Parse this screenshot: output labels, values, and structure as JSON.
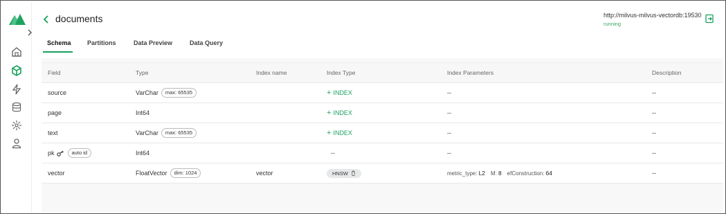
{
  "header": {
    "title": "documents",
    "connection_url": "http://milvus-milvus-vectordb:19530",
    "connection_status": "running"
  },
  "tabs": [
    {
      "label": "Schema",
      "active": true
    },
    {
      "label": "Partitions",
      "active": false
    },
    {
      "label": "Data Preview",
      "active": false
    },
    {
      "label": "Data Query",
      "active": false
    }
  ],
  "table": {
    "columns": [
      "Field",
      "Type",
      "Index name",
      "Index Type",
      "Index Parameters",
      "Description"
    ],
    "rows": [
      {
        "field": "source",
        "type": "VarChar",
        "type_chip": "max: 65535",
        "index_name": "",
        "index_type": "INDEX",
        "params": "--",
        "description": "--"
      },
      {
        "field": "page",
        "type": "Int64",
        "type_chip": "",
        "index_name": "",
        "index_type": "INDEX",
        "params": "--",
        "description": "--"
      },
      {
        "field": "text",
        "type": "VarChar",
        "type_chip": "max: 65535",
        "index_name": "",
        "index_type": "INDEX",
        "params": "--",
        "description": "--"
      },
      {
        "field": "pk",
        "field_chip": "auto id",
        "type": "Int64",
        "index_name": "",
        "index_type": "--",
        "params": "--",
        "description": "--"
      },
      {
        "field": "vector",
        "type": "FloatVector",
        "type_chip": "dim: 1024",
        "index_name": "vector",
        "index_type": "HNSW",
        "params": [
          {
            "key": "metric_type:",
            "value": "L2"
          },
          {
            "key": "M:",
            "value": "8"
          },
          {
            "key": "efConstruction:",
            "value": "64"
          }
        ],
        "description": "--"
      }
    ]
  },
  "colors": {
    "accent": "#17a15c",
    "status_running": "#3aa35c"
  },
  "icons": [
    "milvus-logo-icon",
    "chevron-right-icon",
    "home-icon",
    "cube-icon",
    "lightning-icon",
    "database-icon",
    "network-icon",
    "user-icon",
    "back-arrow-icon",
    "logout-icon",
    "key-icon",
    "trash-icon",
    "plus-icon"
  ]
}
